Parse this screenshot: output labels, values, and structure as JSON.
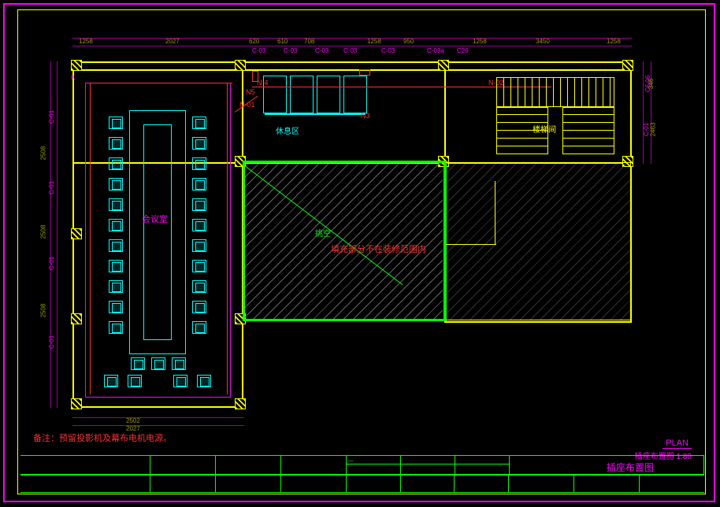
{
  "title_block": {
    "drawing_title": "插座布置图"
  },
  "plan_title": {
    "label": "PLAN",
    "name_scale": "插座布置图  1:80"
  },
  "note": "备注：预留投影机及幕布电机电源。",
  "rooms": {
    "conference": "会议室",
    "rest_area": "休息区",
    "stairwell": "楼梯间",
    "void": "挑空"
  },
  "void_note": "填充部分不在装修范围内",
  "wire_labels": {
    "n01": "N-01",
    "n02": "N-02",
    "n3": "N3",
    "n4": "N-4",
    "n5": "N5"
  },
  "dims_top": [
    "1258",
    "—",
    "2027",
    "—",
    "620",
    "610",
    "708",
    "—",
    "1258",
    "950",
    "C-03a",
    "C26",
    "1258",
    "—",
    "3450",
    "—",
    "1258"
  ],
  "dims_left_sections": [
    "C-01",
    "C-01",
    "C-01",
    "C-01"
  ],
  "dims_left": [
    "2508",
    "2508",
    "2508"
  ],
  "dims_right_top": [
    "C6 06",
    "346",
    "C-01",
    "2463"
  ],
  "dims_bottom_left_sections": [
    "2502",
    "2027"
  ],
  "grid_tags_top": [
    "K",
    "C-03",
    "C-03",
    "C-03",
    "C-03",
    "C-03"
  ]
}
